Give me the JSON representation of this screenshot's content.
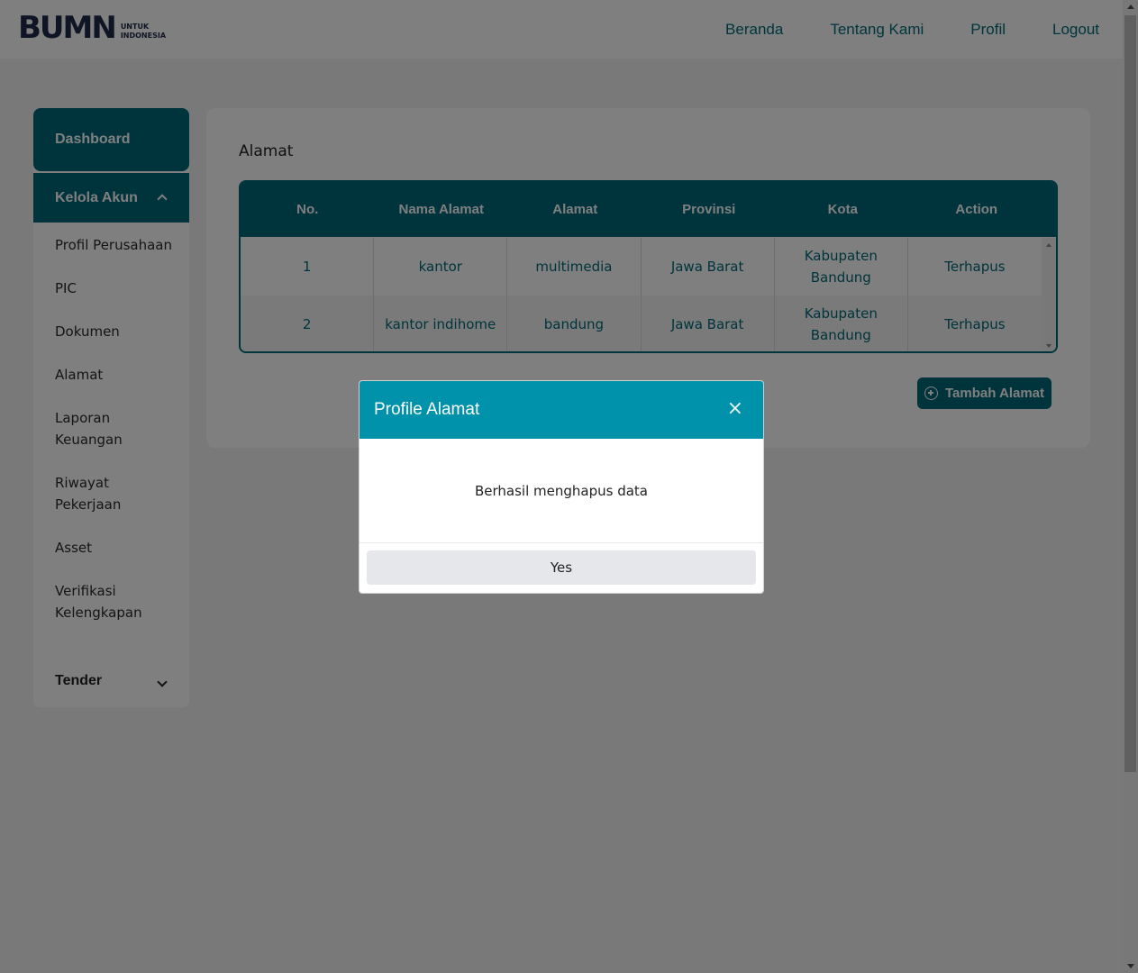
{
  "header": {
    "logo_mark": "BUMN",
    "logo_sub_1": "UNTUK",
    "logo_sub_2": "INDONESIA",
    "nav": [
      "Beranda",
      "Tentang Kami",
      "Profil",
      "Logout"
    ]
  },
  "sidebar": {
    "dashboard": "Dashboard",
    "kelola_akun": "Kelola Akun",
    "items": [
      "Profil Perusahaan",
      "PIC",
      "Dokumen",
      "Alamat",
      "Laporan Keuangan",
      "Riwayat Pekerjaan",
      "Asset",
      "Verifikasi Kelengkapan"
    ],
    "tender": "Tender"
  },
  "main": {
    "title": "Alamat",
    "table": {
      "columns": [
        "No.",
        "Nama Alamat",
        "Alamat",
        "Provinsi",
        "Kota",
        "Action"
      ],
      "rows": [
        [
          "1",
          "kantor",
          "multimedia",
          "Jawa Barat",
          "Kabupaten Bandung",
          "Terhapus"
        ],
        [
          "2",
          "kantor indihome",
          "bandung",
          "Jawa Barat",
          "Kabupaten Bandung",
          "Terhapus"
        ]
      ]
    },
    "add_button": "Tambah Alamat"
  },
  "modal": {
    "title": "Profile Alamat",
    "close": "×",
    "message": "Berhasil menghapus data",
    "confirm": "Yes"
  },
  "colors": {
    "primary": "#00697a",
    "modal_header": "#0092ab",
    "overlay": "rgba(0,0,0,0.5)"
  }
}
